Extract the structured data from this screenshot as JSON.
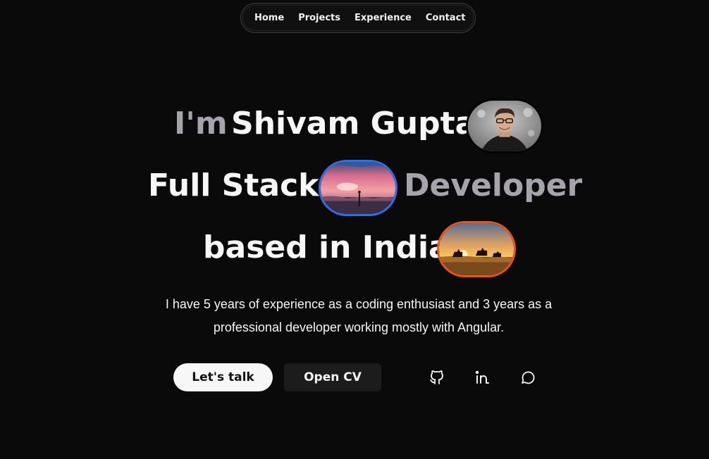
{
  "nav": {
    "items": [
      {
        "label": "Home"
      },
      {
        "label": "Projects"
      },
      {
        "label": "Experience"
      },
      {
        "label": "Contact"
      }
    ]
  },
  "hero": {
    "line1": {
      "part1": "I'm",
      "part2": "Shivam Gupta"
    },
    "line2": {
      "part1": "Full Stack",
      "part2": "Developer"
    },
    "line3": {
      "part1": "based in India"
    },
    "description_line1": "I have 5 years of experience as a coding enthusiast and 3 years as a",
    "description_line2": "professional developer working mostly with Angular."
  },
  "actions": {
    "talk_label": "Let's talk",
    "cv_label": "Open CV"
  },
  "social": {
    "icons": [
      "github-icon",
      "linkedin-icon",
      "chat-icon"
    ]
  },
  "colors": {
    "background": "#0a0a0a",
    "heading_grey": "#a6a3ad",
    "heading_white": "#f7f7f7",
    "pill_blue_border": "#2f6fe8",
    "pill_orange_border": "#e8541c"
  }
}
